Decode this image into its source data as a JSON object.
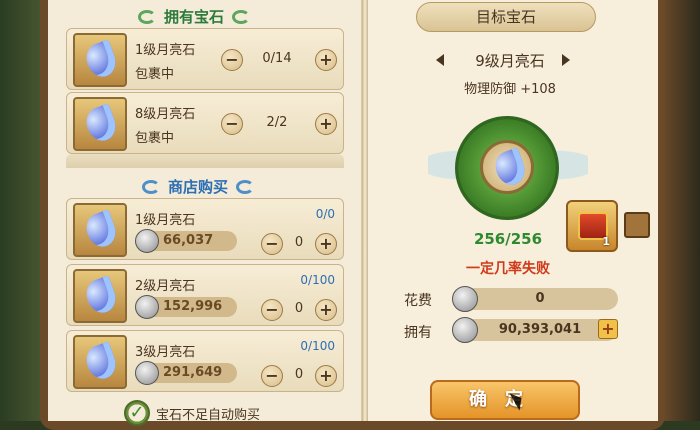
{
  "owned_section": {
    "title": "拥有宝石"
  },
  "owned_items": [
    {
      "name": "1级月亮石",
      "location": "包裹中",
      "qty": "0",
      "max": "14",
      "qty_text": "0/14"
    },
    {
      "name": "8级月亮石",
      "location": "包裹中",
      "qty": "2",
      "max": "2",
      "qty_text": "2/2"
    }
  ],
  "shop_section": {
    "title": "商店购买"
  },
  "shop_items": [
    {
      "name": "1级月亮石",
      "quota": "0/0",
      "price": "66,037",
      "qty": "0"
    },
    {
      "name": "2级月亮石",
      "quota": "0/100",
      "price": "152,996",
      "qty": "0"
    },
    {
      "name": "3级月亮石",
      "quota": "0/100",
      "price": "291,649",
      "qty": "0"
    }
  ],
  "auto_buy": {
    "label": "宝石不足自动购买",
    "checked": true
  },
  "target": {
    "banner": "目标宝石",
    "name": "9级月亮石",
    "stat": "物理防御 +108",
    "progress": "256/256",
    "warning": "一定几率失败",
    "reward_count": "1"
  },
  "cost": {
    "label": "花费",
    "value": "0"
  },
  "owned_money": {
    "label": "拥有",
    "value": "90,393,041"
  },
  "confirm": {
    "label": "确定"
  },
  "icons": {
    "minus": "−",
    "plus": "+",
    "check": "✓"
  },
  "colors": {
    "green_text": "#2e8a2e",
    "warn_red": "#d03a1a",
    "quota_blue": "#2c6fb3"
  }
}
